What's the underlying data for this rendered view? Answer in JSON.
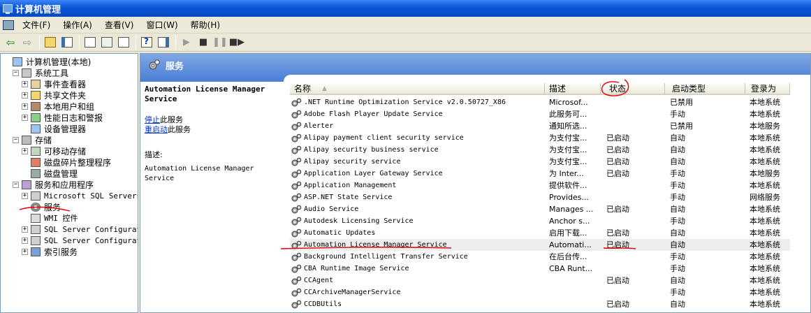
{
  "window": {
    "title": "计算机管理"
  },
  "menu": [
    "文件(F)",
    "操作(A)",
    "查看(V)",
    "窗口(W)",
    "帮助(H)"
  ],
  "tree": [
    {
      "label": "计算机管理(本地)",
      "level": 0,
      "expander": "",
      "icon": "computer"
    },
    {
      "label": "系统工具",
      "level": 1,
      "expander": "−",
      "icon": "tools"
    },
    {
      "label": "事件查看器",
      "level": 2,
      "expander": "+",
      "icon": "event"
    },
    {
      "label": "共享文件夹",
      "level": 2,
      "expander": "+",
      "icon": "share"
    },
    {
      "label": "本地用户和组",
      "level": 2,
      "expander": "+",
      "icon": "users"
    },
    {
      "label": "性能日志和警报",
      "level": 2,
      "expander": "+",
      "icon": "perf"
    },
    {
      "label": "设备管理器",
      "level": 2,
      "expander": "",
      "icon": "device"
    },
    {
      "label": "存储",
      "level": 1,
      "expander": "−",
      "icon": "storage"
    },
    {
      "label": "可移动存储",
      "level": 2,
      "expander": "+",
      "icon": "removable"
    },
    {
      "label": "磁盘碎片整理程序",
      "level": 2,
      "expander": "",
      "icon": "defrag"
    },
    {
      "label": "磁盘管理",
      "level": 2,
      "expander": "",
      "icon": "disk"
    },
    {
      "label": "服务和应用程序",
      "level": 1,
      "expander": "−",
      "icon": "apps"
    },
    {
      "label": "Microsoft SQL Servers",
      "level": 2,
      "expander": "+",
      "icon": "sql"
    },
    {
      "label": "服务",
      "level": 2,
      "expander": "",
      "icon": "gear"
    },
    {
      "label": "WMI 控件",
      "level": 2,
      "expander": "",
      "icon": "wmi"
    },
    {
      "label": "SQL Server Configurati",
      "level": 2,
      "expander": "+",
      "icon": "sql"
    },
    {
      "label": "SQL Server Configurati",
      "level": 2,
      "expander": "+",
      "icon": "sql"
    },
    {
      "label": "索引服务",
      "level": 2,
      "expander": "+",
      "icon": "index"
    }
  ],
  "services_header": {
    "title": "服务"
  },
  "detail": {
    "service_name": "Automation License Manager Service",
    "stop_link": "停止",
    "stop_suffix": "此服务",
    "restart_link": "重启动",
    "restart_suffix": "此服务",
    "description_label": "描述:",
    "description_text": "Automation License Manager Service"
  },
  "columns": [
    "名称",
    "描述",
    "状态",
    "启动类型",
    "登录为"
  ],
  "rows": [
    {
      "name": ".NET Runtime Optimization Service v2.0.50727_X86",
      "desc": "Microsof...",
      "status": "",
      "startup": "已禁用",
      "logon": "本地系统"
    },
    {
      "name": "Adobe Flash Player Update Service",
      "desc": "此服务可...",
      "status": "",
      "startup": "手动",
      "logon": "本地系统"
    },
    {
      "name": "Alerter",
      "desc": "通知所选...",
      "status": "",
      "startup": "已禁用",
      "logon": "本地服务"
    },
    {
      "name": "Alipay payment client security service",
      "desc": "为支付宝...",
      "status": "已启动",
      "startup": "自动",
      "logon": "本地系统"
    },
    {
      "name": "Alipay security business service",
      "desc": "为支付宝...",
      "status": "已启动",
      "startup": "自动",
      "logon": "本地系统"
    },
    {
      "name": "Alipay security service",
      "desc": "为支付宝...",
      "status": "已启动",
      "startup": "自动",
      "logon": "本地系统"
    },
    {
      "name": "Application Layer Gateway Service",
      "desc": "为 Inter...",
      "status": "已启动",
      "startup": "手动",
      "logon": "本地服务"
    },
    {
      "name": "Application Management",
      "desc": "提供软件...",
      "status": "",
      "startup": "手动",
      "logon": "本地系统"
    },
    {
      "name": "ASP.NET State Service",
      "desc": "Provides...",
      "status": "",
      "startup": "手动",
      "logon": "网络服务"
    },
    {
      "name": "Audio Service",
      "desc": "Manages ...",
      "status": "已启动",
      "startup": "自动",
      "logon": "本地系统"
    },
    {
      "name": "Autodesk Licensing Service",
      "desc": "Anchor s...",
      "status": "",
      "startup": "手动",
      "logon": "本地系统"
    },
    {
      "name": "Automatic Updates",
      "desc": "启用下载...",
      "status": "已启动",
      "startup": "自动",
      "logon": "本地系统"
    },
    {
      "name": "Automation License Manager Service",
      "desc": "Automati...",
      "status": "已启动",
      "startup": "自动",
      "logon": "本地系统",
      "selected": true
    },
    {
      "name": "Background Intelligent Transfer Service",
      "desc": "在后台传...",
      "status": "",
      "startup": "手动",
      "logon": "本地系统"
    },
    {
      "name": "CBA Runtime Image Service",
      "desc": "CBA Runt...",
      "status": "",
      "startup": "手动",
      "logon": "本地系统"
    },
    {
      "name": "CCAgent",
      "desc": "",
      "status": "已启动",
      "startup": "自动",
      "logon": "本地系统"
    },
    {
      "name": "CCArchiveManagerService",
      "desc": "",
      "status": "",
      "startup": "手动",
      "logon": "本地系统"
    },
    {
      "name": "CCDBUtils",
      "desc": "",
      "status": "已启动",
      "startup": "自动",
      "logon": "本地系统"
    }
  ],
  "colors": {
    "annotation": "#e00000",
    "link": "#0033cc",
    "title_bar": "#0a57d9",
    "header_blue": "#4a7fd6"
  }
}
